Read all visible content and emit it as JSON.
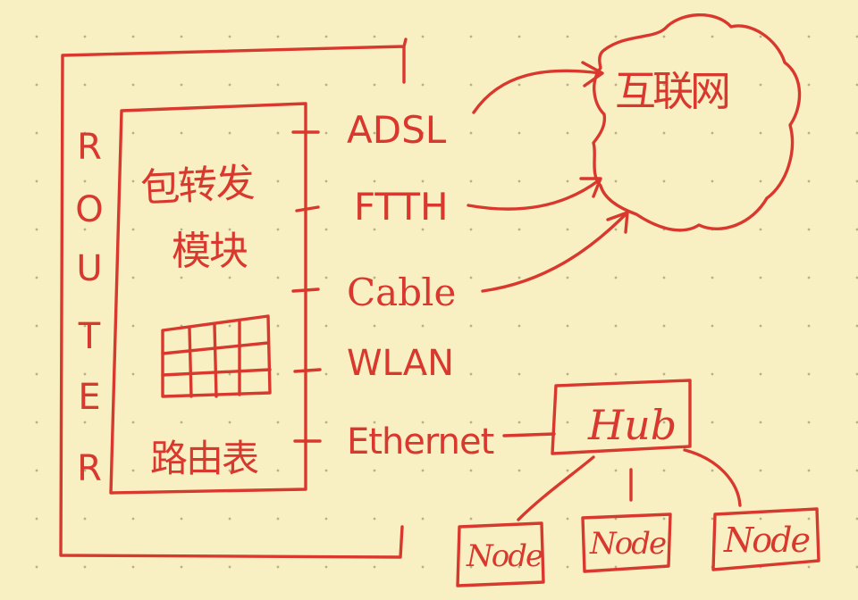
{
  "router": {
    "label_letters": [
      "R",
      "O",
      "U",
      "T",
      "E",
      "R"
    ]
  },
  "modules": {
    "forwarding_line1": "包转发",
    "forwarding_line2": "模块",
    "routing_table": "路由表"
  },
  "interfaces": [
    "ADSL",
    "FTTH",
    "Cable",
    "WLAN",
    "Ethernet"
  ],
  "internet": {
    "label": "互联网"
  },
  "hub": {
    "label": "Hub"
  },
  "nodes": [
    "Node",
    "Node",
    "Node"
  ],
  "colors": {
    "ink": "#d8382d",
    "paper": "#f8f0c2",
    "grid_dot": "#b9b08a"
  }
}
